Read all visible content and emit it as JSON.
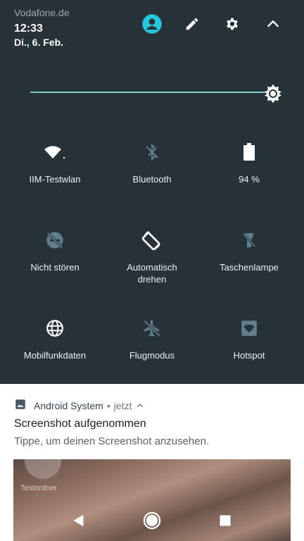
{
  "status": {
    "carrier": "Vodafone.de",
    "time": "12:33",
    "date": "Di., 6. Feb."
  },
  "header_icons": [
    "account-icon",
    "edit-icon",
    "settings-icon",
    "collapse-icon"
  ],
  "brightness": {
    "level": 1.0,
    "accent": "#80cbc4"
  },
  "tiles": [
    {
      "label": "IIM-Testwlan",
      "icon": "wifi-icon",
      "active": true
    },
    {
      "label": "Bluetooth",
      "icon": "bluetooth-off-icon",
      "active": false
    },
    {
      "label": "94 %",
      "icon": "battery-icon",
      "active": true
    },
    {
      "label": "Nicht stören",
      "icon": "do-not-disturb-off-icon",
      "active": false
    },
    {
      "label": "Automatisch drehen",
      "icon": "auto-rotate-icon",
      "active": true
    },
    {
      "label": "Taschenlampe",
      "icon": "flashlight-off-icon",
      "active": false
    },
    {
      "label": "Mobilfunkdaten",
      "icon": "globe-icon",
      "active": true
    },
    {
      "label": "Flugmodus",
      "icon": "airplane-off-icon",
      "active": false
    },
    {
      "label": "Hotspot",
      "icon": "hotspot-icon",
      "active": false
    }
  ],
  "notification": {
    "app": "Android System",
    "separator": "•",
    "when": "jetzt",
    "title": "Screenshot aufgenommen",
    "text": "Tippe, um deinen Screenshot anzusehen.",
    "preview_label": "Testordner"
  },
  "nav": [
    "back-icon",
    "home-icon",
    "recents-icon"
  ],
  "colors": {
    "shade_bg": "#263238",
    "active_icon": "#ffffff",
    "inactive_icon": "#607d8b",
    "account_icon": "#26c6da"
  }
}
